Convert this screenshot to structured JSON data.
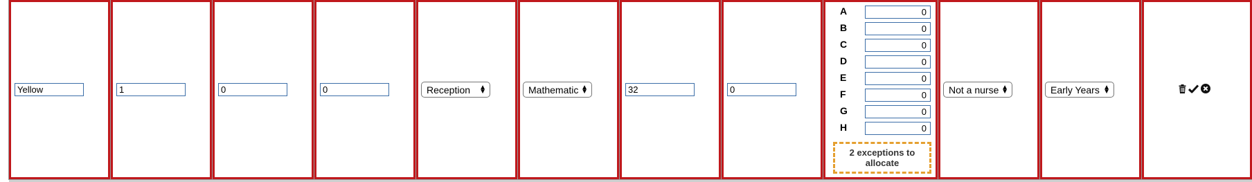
{
  "row": {
    "name": "Yellow",
    "size": "1",
    "field3": "0",
    "field4": "0",
    "year_group": "Reception",
    "subject": "Mathematics",
    "capacity": "32",
    "field8": "0",
    "grades": [
      {
        "label": "A",
        "value": "0"
      },
      {
        "label": "B",
        "value": "0"
      },
      {
        "label": "C",
        "value": "0"
      },
      {
        "label": "D",
        "value": "0"
      },
      {
        "label": "E",
        "value": "0"
      },
      {
        "label": "F",
        "value": "0"
      },
      {
        "label": "G",
        "value": "0"
      },
      {
        "label": "H",
        "value": "0"
      }
    ],
    "exceptions_text": "2 exceptions to allocate",
    "nursery": "Not a nursery",
    "framework": "Early Years Fc"
  },
  "icons": [
    "trash-icon",
    "check-icon",
    "close-circle-icon"
  ],
  "colors": {
    "cell_border": "#c0181c",
    "input_border": "#3c6ea8",
    "exceptions_border": "#e5a030"
  }
}
